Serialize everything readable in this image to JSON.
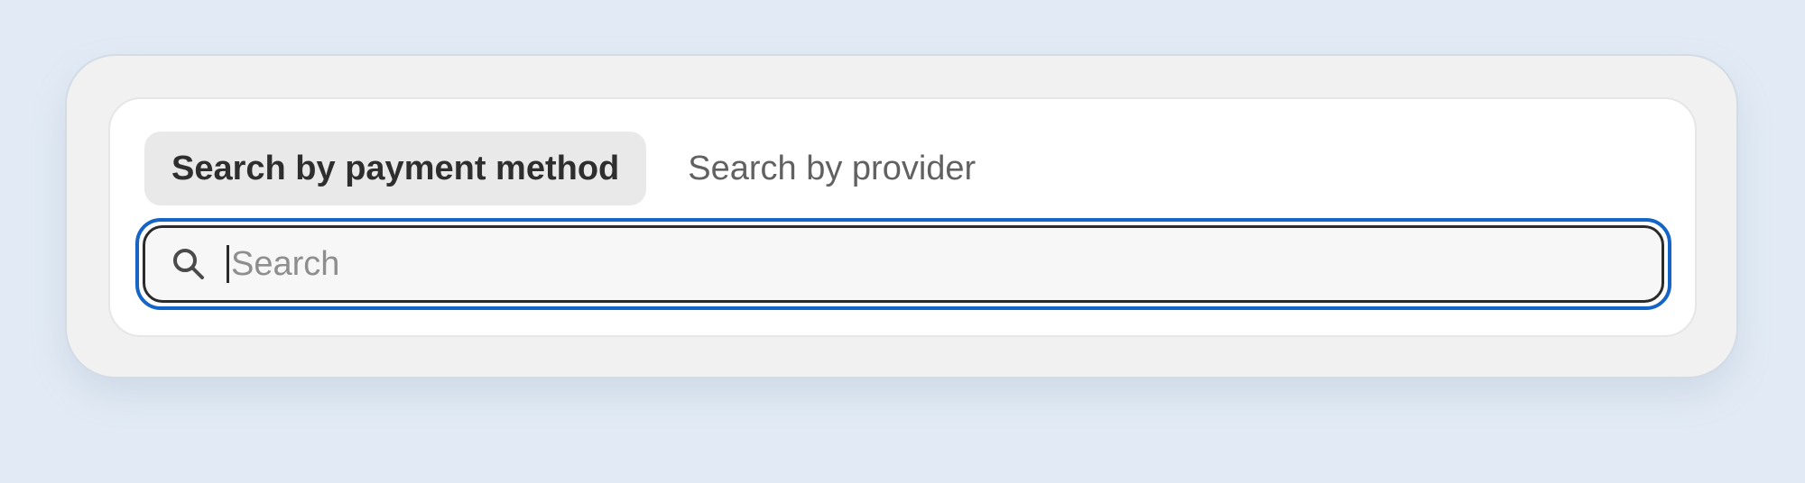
{
  "tabs": [
    {
      "label": "Search by payment method",
      "active": true
    },
    {
      "label": "Search by provider",
      "active": false
    }
  ],
  "search": {
    "placeholder": "Search",
    "value": "",
    "icon": "search-icon"
  },
  "colors": {
    "background": "#e2ebf5",
    "focus_ring": "#1565c6",
    "active_tab_bg": "#e9e9e9"
  }
}
